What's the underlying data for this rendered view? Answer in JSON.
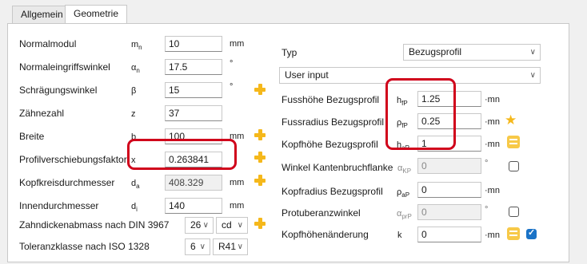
{
  "tabs": [
    {
      "label": "Allgemein"
    },
    {
      "label": "Geometrie"
    }
  ],
  "left": [
    {
      "label": "Normalmodul",
      "symbol": "m",
      "sub": "n",
      "value": "10",
      "unit": "mm"
    },
    {
      "label": "Normaleingriffswinkel",
      "symbol": "α",
      "sub": "n",
      "value": "17.5",
      "unit": "°"
    },
    {
      "label": "Schrägungswinkel",
      "symbol": "β",
      "sub": "",
      "value": "15",
      "unit": "°"
    },
    {
      "label": "Zähnezahl",
      "symbol": "z",
      "sub": "",
      "value": "37",
      "unit": ""
    },
    {
      "label": "Breite",
      "symbol": "b",
      "sub": "",
      "value": "100",
      "unit": "mm"
    },
    {
      "label": "Profilverschiebungsfaktor",
      "symbol": "x",
      "sub": "",
      "value": "0.263841",
      "unit": ""
    },
    {
      "label": "Kopfkreisdurchmesser",
      "symbol": "d",
      "sub": "a",
      "value": "408.329",
      "unit": "mm"
    },
    {
      "label": "Innendurchmesser",
      "symbol": "d",
      "sub": "i",
      "value": "140",
      "unit": "mm"
    },
    {
      "label": "Zahndickenabmass nach DIN 3967",
      "combo1": "26",
      "combo2": "cd"
    },
    {
      "label": "Toleranzklasse nach ISO 1328",
      "combo1": "6",
      "combo2": "R41"
    }
  ],
  "right": {
    "typ_label": "Typ",
    "typ_value": "Bezugsprofil",
    "input_mode": "User input",
    "rows": [
      {
        "label": "Fusshöhe Bezugsprofil",
        "symbol": "h",
        "sub": "fP",
        "value": "1.25",
        "unit": "·mn"
      },
      {
        "label": "Fussradius Bezugsprofil",
        "symbol": "ρ",
        "sub": "fP",
        "value": "0.25",
        "unit": "·mn"
      },
      {
        "label": "Kopfhöhe Bezugsprofil",
        "symbol": "h",
        "sub": "aP",
        "value": "1",
        "unit": "·mn"
      },
      {
        "label": "Winkel Kantenbruchflanke",
        "symbol": "α",
        "sub": "KP",
        "value": "0",
        "unit": "°"
      },
      {
        "label": "Kopfradius Bezugsprofil",
        "symbol": "ρ",
        "sub": "aP",
        "value": "0",
        "unit": "·mn"
      },
      {
        "label": "Protuberanzwinkel",
        "symbol": "α",
        "sub": "prP",
        "value": "0",
        "unit": "°"
      },
      {
        "label": "Kopfhöhenänderung",
        "symbol": "k",
        "sub": "",
        "value": "0",
        "unit": "·mn"
      }
    ]
  }
}
